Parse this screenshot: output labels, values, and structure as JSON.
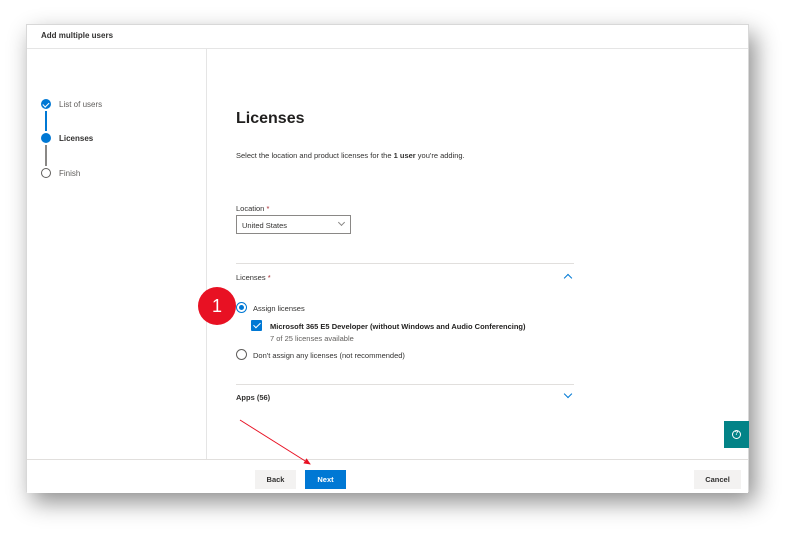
{
  "window": {
    "title": "Add multiple users"
  },
  "steps": [
    {
      "label": "List of users",
      "state": "done"
    },
    {
      "label": "Licenses",
      "state": "current"
    },
    {
      "label": "Finish",
      "state": "pending"
    }
  ],
  "main": {
    "heading": "Licenses",
    "description_pre": "Select the location and product licenses for the ",
    "description_bold": "1 user",
    "description_post": " you're adding.",
    "location_label": "Location",
    "required_marker": "*",
    "location_value": "United States",
    "licenses_label": "Licenses",
    "assign_label": "Assign licenses",
    "license_name": "Microsoft 365 E5 Developer (without Windows and Audio Conferencing)",
    "license_availability": "7 of 25 licenses available",
    "dont_assign_label": "Don't assign any licenses (not recommended)",
    "apps_label": "Apps (56)"
  },
  "footer": {
    "back_label": "Back",
    "next_label": "Next",
    "cancel_label": "Cancel"
  },
  "help": {
    "icon": "question-icon",
    "glyph": "?"
  },
  "annotation": {
    "badge_number": "1",
    "color": "#e81123"
  },
  "colors": {
    "accent": "#0078d4",
    "help": "#038387",
    "annotation": "#e81123"
  }
}
